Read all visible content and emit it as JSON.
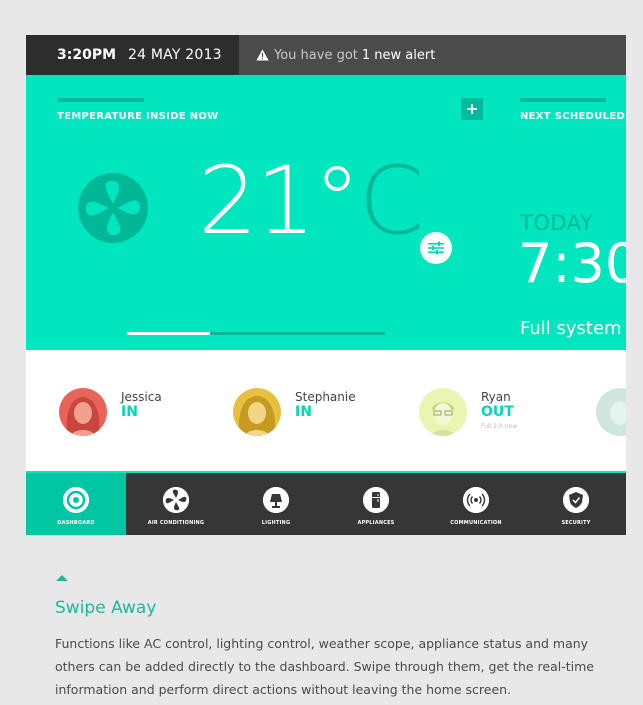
{
  "status": {
    "time": "3:20PM",
    "date": "24 MAY 2013",
    "alert_prefix": "You have got",
    "alert_strong": "1 new alert"
  },
  "temperature": {
    "label": "TEMPERATURE INSIDE NOW",
    "value": "21°",
    "unit": "C",
    "slider_level": 0.32
  },
  "schedule": {
    "label": "NEXT SCHEDULED EV",
    "when": "TODAY",
    "time": "7:30",
    "description": "Full system c"
  },
  "people": [
    {
      "name": "Jessica",
      "status": "IN",
      "note": ""
    },
    {
      "name": "Stephanie",
      "status": "IN",
      "note": ""
    },
    {
      "name": "Ryan",
      "status": "OUT",
      "note": "Full 2-h now"
    }
  ],
  "nav": [
    {
      "label": "DASHBOARD",
      "icon": "dashboard-icon"
    },
    {
      "label": "AIR CONDITIONING",
      "icon": "fan-icon"
    },
    {
      "label": "LIGHTING",
      "icon": "lamp-icon"
    },
    {
      "label": "APPLIANCES",
      "icon": "fridge-icon"
    },
    {
      "label": "COMMUNICATION",
      "icon": "broadcast-icon"
    },
    {
      "label": "SECURITY",
      "icon": "shield-icon"
    }
  ],
  "section": {
    "title": "Swipe Away",
    "body": "Functions like AC control, lighting control, weather scope, appliance status and many others can be added directly to the dashboard. Swipe through them, get the real-time information and perform direct actions without leaving the home screen."
  },
  "colors": {
    "accent": "#02e6c0",
    "accent_dark": "#01b99b",
    "nav_bg": "#363636"
  }
}
